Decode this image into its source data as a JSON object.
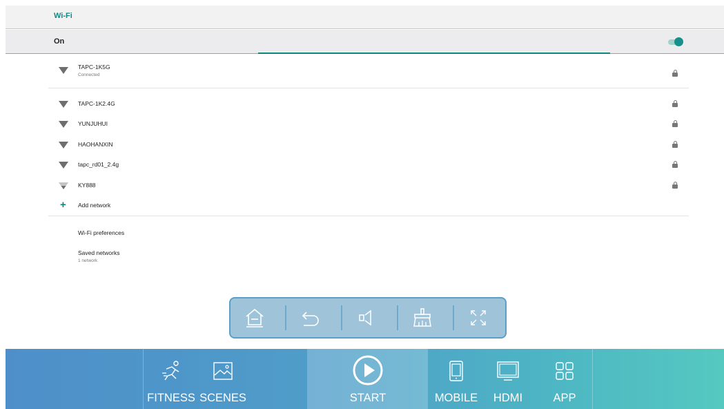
{
  "header": {
    "title": "Wi-Fi"
  },
  "wifi_toggle": {
    "label": "On",
    "state": "on",
    "accent_color": "#16908a"
  },
  "networks": [
    {
      "name": "TAPC-1K5G",
      "status": "Connected",
      "secured": true,
      "signal": "full"
    },
    {
      "name": "TAPC-1K2.4G",
      "status": "",
      "secured": true,
      "signal": "full"
    },
    {
      "name": "YUNJUHUI",
      "status": "",
      "secured": true,
      "signal": "full"
    },
    {
      "name": "HAOHANXIN",
      "status": "",
      "secured": true,
      "signal": "full"
    },
    {
      "name": "tapc_rd01_2.4g",
      "status": "",
      "secured": true,
      "signal": "full"
    },
    {
      "name": "KY888",
      "status": "",
      "secured": true,
      "signal": "weak"
    }
  ],
  "add_network": {
    "label": "Add network",
    "icon": "plus-icon"
  },
  "preferences": {
    "label": "Wi-Fi preferences"
  },
  "saved_networks": {
    "label": "Saved networks",
    "sub": "1 network"
  },
  "float_toolbar": {
    "buttons": [
      {
        "icon": "home-icon"
      },
      {
        "icon": "back-icon"
      },
      {
        "icon": "volume-icon"
      },
      {
        "icon": "clean-icon"
      },
      {
        "icon": "fullscreen-icon"
      }
    ]
  },
  "dock": {
    "items": [
      {
        "label": "FITNESS",
        "icon": "running-man-icon"
      },
      {
        "label": "SCENES",
        "icon": "landscape-image-icon"
      },
      {
        "label": "START",
        "icon": "play-circle-icon",
        "active": true
      },
      {
        "label": "MOBILE",
        "icon": "tablet-icon"
      },
      {
        "label": "HDMI",
        "icon": "monitor-icon"
      },
      {
        "label": "APP",
        "icon": "app-grid-icon"
      }
    ]
  }
}
